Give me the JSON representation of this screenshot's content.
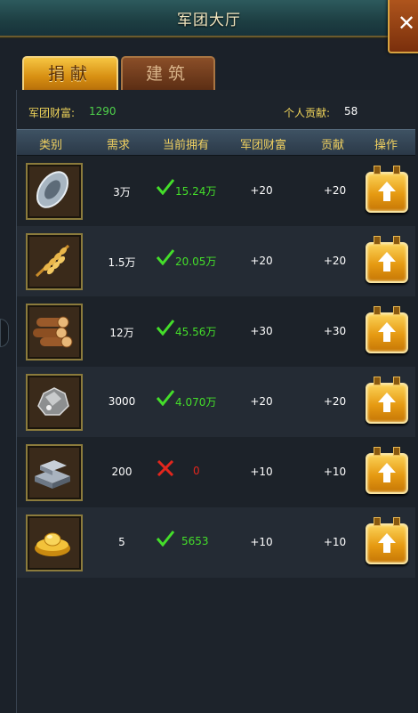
{
  "window": {
    "title": "军团大厅",
    "close_icon": "close-icon"
  },
  "tabs": [
    {
      "label": "捐献",
      "active": true
    },
    {
      "label": "建筑",
      "active": false
    }
  ],
  "stats": {
    "legion_wealth_label": "军团财富:",
    "legion_wealth_value": "1290",
    "personal_contribution_label": "个人贡献:",
    "personal_contribution_value": "58"
  },
  "table": {
    "columns": [
      "类别",
      "需求",
      "当前拥有",
      "军团财富",
      "贡献",
      "操作"
    ],
    "rows": [
      {
        "icon": "coin-icon",
        "required": "3万",
        "owned": "15.24万",
        "enough": true,
        "wealth": "+20",
        "contribution": "+20"
      },
      {
        "icon": "wheat-icon",
        "required": "1.5万",
        "owned": "20.05万",
        "enough": true,
        "wealth": "+20",
        "contribution": "+20"
      },
      {
        "icon": "wood-logs-icon",
        "required": "12万",
        "owned": "45.56万",
        "enough": true,
        "wealth": "+30",
        "contribution": "+30"
      },
      {
        "icon": "ore-icon",
        "required": "3000",
        "owned": "4.070万",
        "enough": true,
        "wealth": "+20",
        "contribution": "+20"
      },
      {
        "icon": "iron-ingot-icon",
        "required": "200",
        "owned": "0",
        "enough": false,
        "wealth": "+10",
        "contribution": "+10"
      },
      {
        "icon": "gold-ingot-icon",
        "required": "5",
        "owned": "5653",
        "enough": true,
        "wealth": "+10",
        "contribution": "+10"
      }
    ]
  },
  "colors": {
    "ok": "#44de2a",
    "bad": "#e2261d",
    "gold_label": "#f0d45a",
    "button": "#e69a12"
  }
}
